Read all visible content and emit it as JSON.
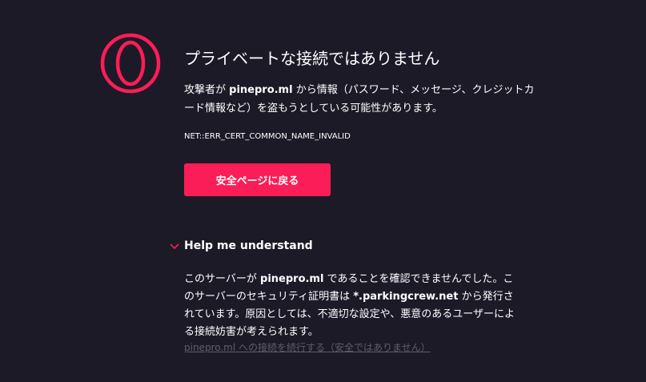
{
  "header": {
    "logo_icon": "opera-gx-logo-icon",
    "title": "プライベートな接続ではありません"
  },
  "description": {
    "prefix": "攻撃者が ",
    "domain": "pinepro.ml",
    "suffix": " から情報（パスワード、メッセージ、クレジットカード情報など）を盗もうとしている可能性があります。"
  },
  "error_code": "NET::ERR_CERT_COMMON_NAME_INVALID",
  "buttons": {
    "back_label": "安全ページに戻る"
  },
  "help": {
    "toggle_label": "Help me understand",
    "chevron_icon": "chevron-down-icon",
    "detail": {
      "part1": "このサーバーが ",
      "domain": "pinepro.ml",
      "part2": " であることを確認できませんでした。このサーバーのセキュリティ証明書は ",
      "cert_domain": "*.parkingcrew.net",
      "part3": " から発行されています。原因としては、不適切な設定や、悪意のあるユーザーによる接続妨害が考えられます。"
    },
    "proceed_link": "pinepro.ml への接続を続行する（安全ではありません）"
  },
  "colors": {
    "background": "#1c1a27",
    "accent": "#fb1d57",
    "muted_link": "#5f5c6c"
  }
}
